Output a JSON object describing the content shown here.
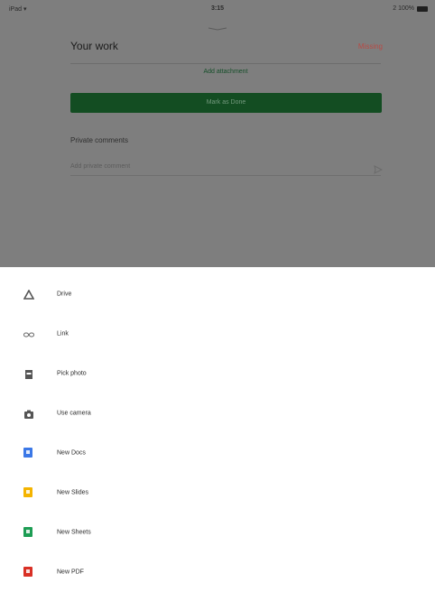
{
  "status_bar": {
    "left": "iPad ▾",
    "time": "3:15",
    "right": "2 100%"
  },
  "card": {
    "title": "Your work",
    "status": "Missing",
    "add_attachment_label": "Add attachment",
    "mark_done_label": "Mark as Done",
    "private_comments_title": "Private comments",
    "private_comment_placeholder": "Add private comment"
  },
  "sheet": {
    "items": [
      {
        "label": "Drive",
        "icon": "drive-icon"
      },
      {
        "label": "Link",
        "icon": "link-icon"
      },
      {
        "label": "Pick photo",
        "icon": "photo-icon"
      },
      {
        "label": "Use camera",
        "icon": "camera-icon"
      },
      {
        "label": "New Docs",
        "icon": "docs-icon",
        "color": "#3b78e7"
      },
      {
        "label": "New Slides",
        "icon": "slides-icon",
        "color": "#f4b400"
      },
      {
        "label": "New Sheets",
        "icon": "sheets-icon",
        "color": "#1e9d54"
      },
      {
        "label": "New PDF",
        "icon": "pdf-icon",
        "color": "#d93025"
      }
    ]
  },
  "colors": {
    "overlay": "#7e7e7e",
    "done_button": "#134d22",
    "missing": "#b84a45"
  }
}
